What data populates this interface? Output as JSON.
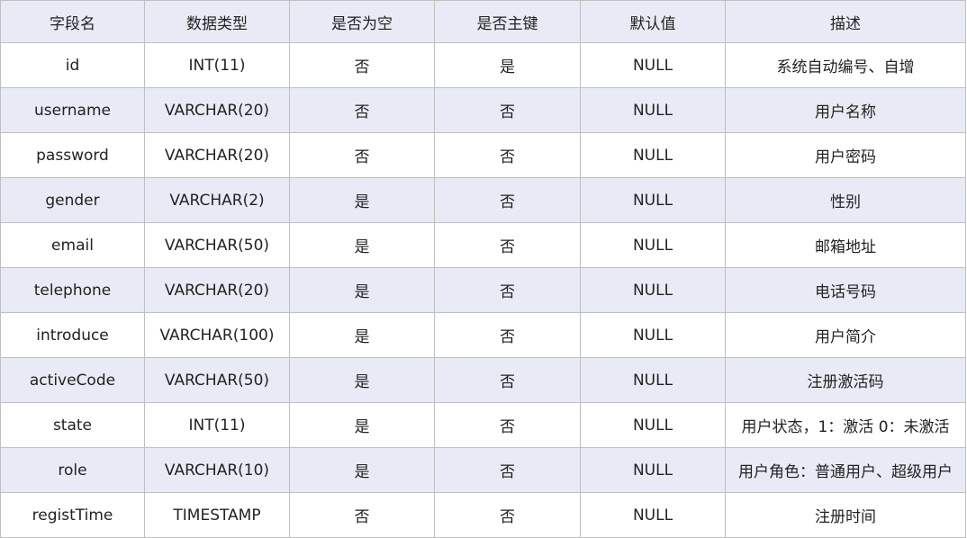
{
  "table": {
    "headers": [
      "字段名",
      "数据类型",
      "是否为空",
      "是否主键",
      "默认值",
      "描述"
    ],
    "rows": [
      [
        "id",
        "INT(11)",
        "否",
        "是",
        "NULL",
        "系统自动编号、自增"
      ],
      [
        "username",
        "VARCHAR(20)",
        "否",
        "否",
        "NULL",
        "用户名称"
      ],
      [
        "password",
        "VARCHAR(20)",
        "否",
        "否",
        "NULL",
        "用户密码"
      ],
      [
        "gender",
        "VARCHAR(2)",
        "是",
        "否",
        "NULL",
        "性别"
      ],
      [
        "email",
        "VARCHAR(50)",
        "是",
        "否",
        "NULL",
        "邮箱地址"
      ],
      [
        "telephone",
        "VARCHAR(20)",
        "是",
        "否",
        "NULL",
        "电话号码"
      ],
      [
        "introduce",
        "VARCHAR(100)",
        "是",
        "否",
        "NULL",
        "用户简介"
      ],
      [
        "activeCode",
        "VARCHAR(50)",
        "是",
        "否",
        "NULL",
        "注册激活码"
      ],
      [
        "state",
        "INT(11)",
        "是",
        "否",
        "NULL",
        "用户状态，1：激活 0：未激活"
      ],
      [
        "role",
        "VARCHAR(10)",
        "是",
        "否",
        "NULL",
        "用户角色：普通用户、超级用户"
      ],
      [
        "registTime",
        "TIMESTAMP",
        "否",
        "否",
        "NULL",
        "注册时间"
      ]
    ]
  },
  "colors": {
    "header_bg": "#e8ebf5",
    "stripe_bg": "#e8ebf5",
    "border": "#bfbfbf"
  }
}
